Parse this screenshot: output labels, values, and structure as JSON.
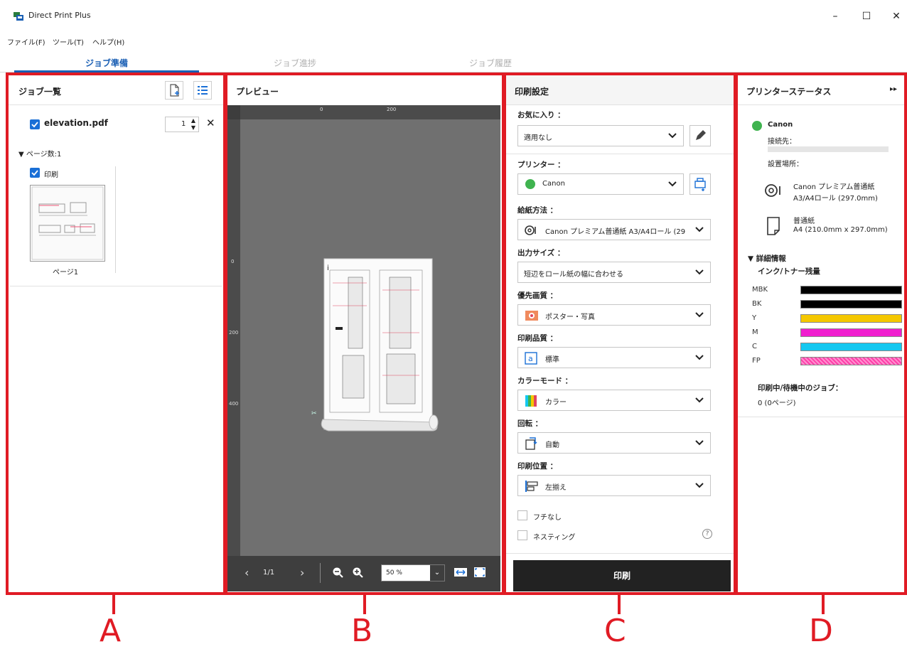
{
  "window": {
    "title": "Direct Print Plus",
    "minimize": "–",
    "maximize": "☐",
    "close": "✕"
  },
  "menu": [
    "ファイル(F)",
    "ツール(T)",
    "ヘルプ(H)"
  ],
  "tabs": [
    {
      "label": "ジョブ準備",
      "active": true
    },
    {
      "label": "ジョブ進捗",
      "active": false
    },
    {
      "label": "ジョブ履歴",
      "active": false
    }
  ],
  "job_list": {
    "title": "ジョブ一覧",
    "file_name": "elevation.pdf",
    "copies": "1",
    "page_count_label": "▼ ページ数:1",
    "print_label": "印刷",
    "page_label": "ページ1"
  },
  "preview": {
    "title": "プレビュー",
    "ruler_top": [
      "0",
      "200"
    ],
    "ruler_left": [
      "0",
      "200",
      "400"
    ],
    "page_indicator": "1/1",
    "zoom": "50 %"
  },
  "settings": {
    "title": "印刷設定",
    "favorites_label": "お気に入り ：",
    "favorites_value": "適用なし",
    "printer_label": "プリンター ：",
    "printer_value": "Canon",
    "feed_label": "給紙方法 ：",
    "feed_value": "Canon プレミアム普通紙 A3/A4ロール (29",
    "output_size_label": "出力サイズ ：",
    "output_size_value": "短辺をロール紙の幅に合わせる",
    "priority_label": "優先画質 ：",
    "priority_value": "ポスター・写真",
    "quality_label": "印刷品質 ：",
    "quality_value": "標準",
    "color_mode_label": "カラーモード ：",
    "color_mode_value": "カラー",
    "rotation_label": "回転 ：",
    "rotation_value": "自動",
    "position_label": "印刷位置 ：",
    "position_value": "左揃え",
    "borderless_label": "フチなし",
    "nesting_label": "ネスティング",
    "help_icon": "?",
    "print_button": "印刷"
  },
  "status": {
    "title": "プリンターステータス",
    "expand_icon": "▸▸",
    "printer_name": "Canon",
    "connection_label": "接続先：",
    "location_label": "設置場所：",
    "roll_media": "Canon プレミアム普通紙",
    "roll_size": "A3/A4ロール (297.0mm)",
    "sheet_media": "普通紙",
    "sheet_size": "A4 (210.0mm x 297.0mm)",
    "details_label": "▼ 詳細情報",
    "ink_label": "インク/トナー残量",
    "inks": [
      {
        "name": "MBK",
        "color": "#000000"
      },
      {
        "name": "BK",
        "color": "#000000"
      },
      {
        "name": "Y",
        "color": "#f5c800"
      },
      {
        "name": "M",
        "color": "#f01ecf"
      },
      {
        "name": "C",
        "color": "#14c8f0"
      },
      {
        "name": "FP",
        "color": "#ff3fa8"
      }
    ],
    "jobs_label": "印刷中/待機中のジョブ：",
    "jobs_value": "0 (0ページ)"
  },
  "callouts": [
    "A",
    "B",
    "C",
    "D"
  ],
  "colors": {
    "accent": "#1a5fb4",
    "outline": "#e01b24",
    "print_button": "#222222"
  }
}
